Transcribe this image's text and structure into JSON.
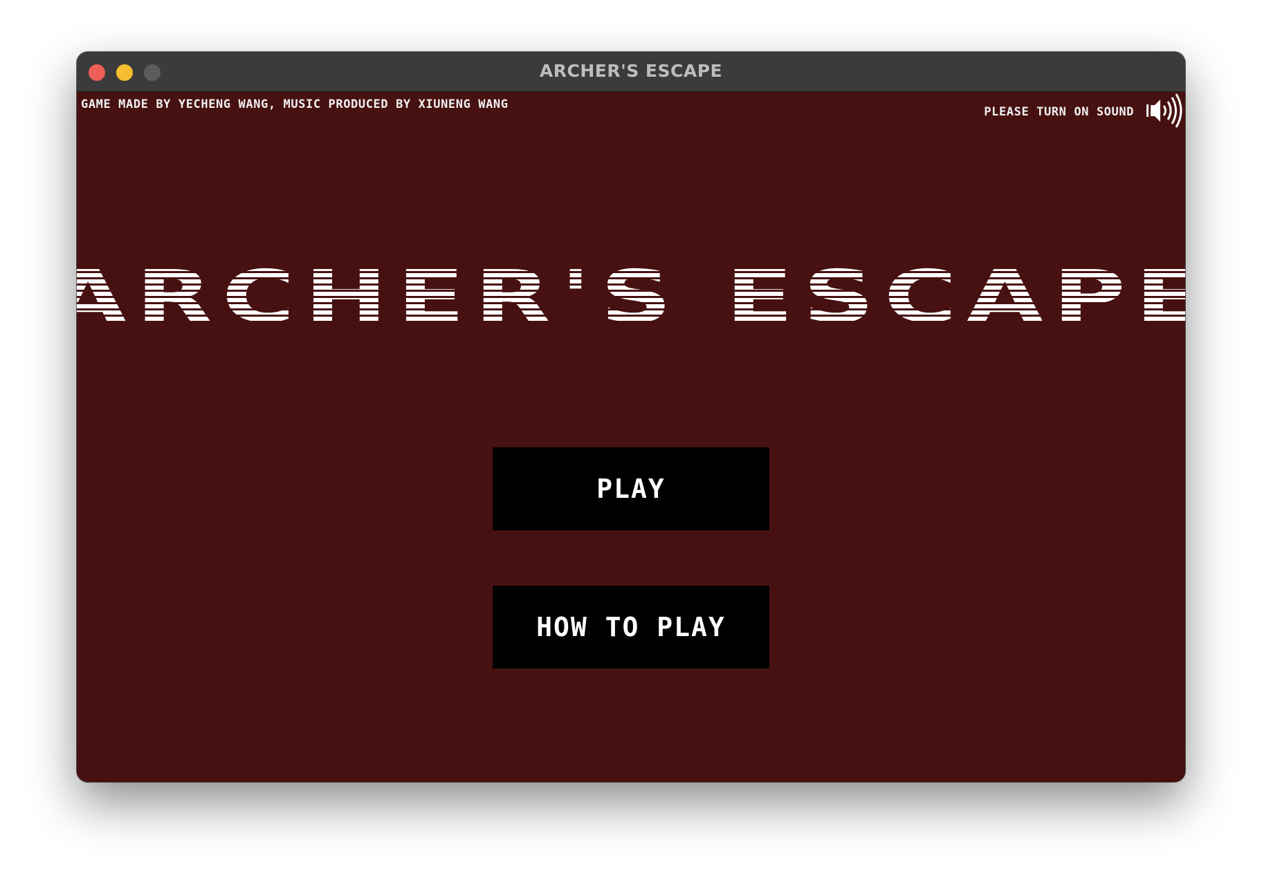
{
  "window": {
    "title": "ARCHER'S ESCAPE"
  },
  "game": {
    "credits": "GAME MADE BY YECHENG WANG, MUSIC PRODUCED BY XIUNENG WANG",
    "sound_hint": "PLEASE TURN ON SOUND",
    "sound_icon": "speaker-icon",
    "title": "ARCHER'S ESCAPE",
    "buttons": {
      "play": "PLAY",
      "how_to_play": "HOW TO PLAY"
    }
  },
  "colors": {
    "background": "#471111",
    "button_bg": "#000000",
    "text": "#ffffff",
    "titlebar": "#3b3b3b"
  }
}
